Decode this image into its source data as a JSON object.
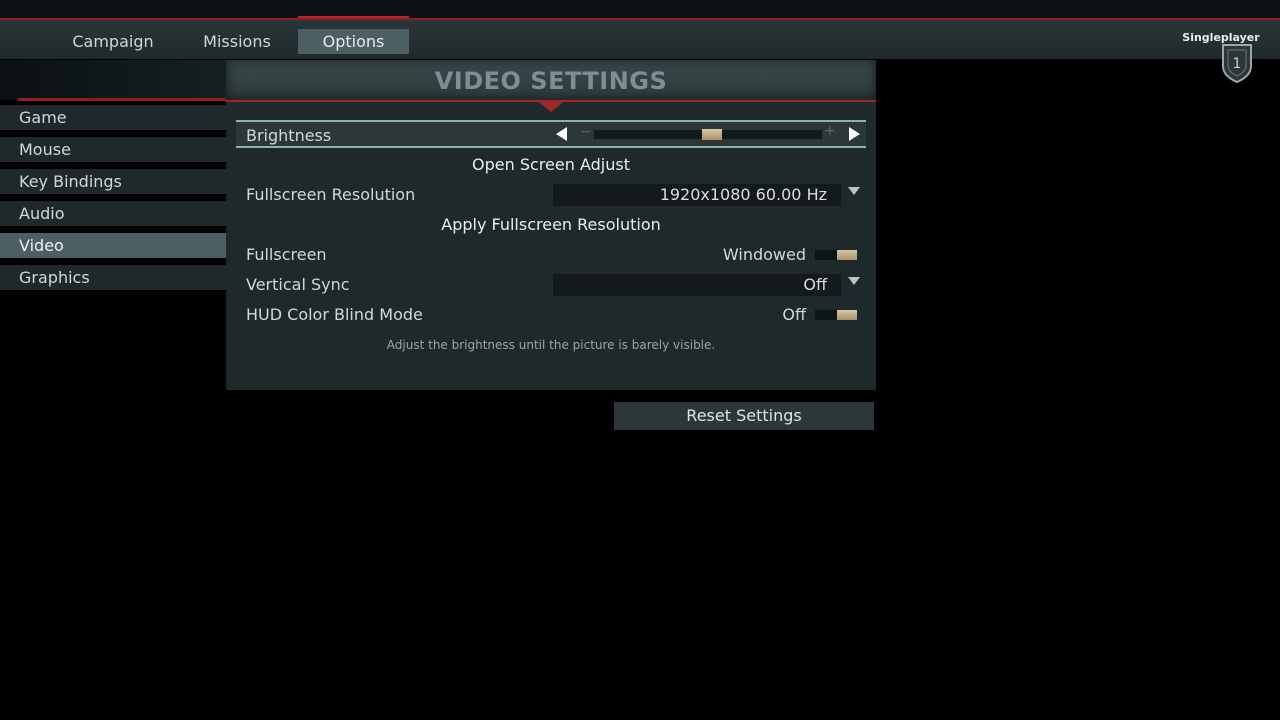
{
  "top_nav": {
    "tabs": [
      {
        "label": "Campaign"
      },
      {
        "label": "Missions"
      },
      {
        "label": "Options"
      }
    ],
    "active_tab": "Options",
    "mode_label": "Singleplayer",
    "mode_badge_number": "1"
  },
  "sidebar": {
    "items": [
      {
        "label": "Game"
      },
      {
        "label": "Mouse"
      },
      {
        "label": "Key Bindings"
      },
      {
        "label": "Audio"
      },
      {
        "label": "Video"
      },
      {
        "label": "Graphics"
      }
    ],
    "active_item": "Video"
  },
  "panel": {
    "title": "VIDEO SETTINGS",
    "brightness": {
      "label": "Brightness",
      "minus": "−",
      "plus": "+",
      "level_fraction": 0.52
    },
    "open_screen_adjust": "Open Screen Adjust",
    "fullscreen_resolution": {
      "label": "Fullscreen Resolution",
      "value": "1920x1080 60.00 Hz"
    },
    "apply_fullscreen_resolution": "Apply Fullscreen Resolution",
    "fullscreen": {
      "label": "Fullscreen",
      "value": "Windowed"
    },
    "vertical_sync": {
      "label": "Vertical Sync",
      "value": "Off"
    },
    "hud_color_blind_mode": {
      "label": "HUD Color Blind Mode",
      "value": "Off"
    },
    "hint": "Adjust the brightness until the picture is barely visible."
  },
  "reset_button_label": "Reset Settings",
  "colors": {
    "accent_red": "#a1262a",
    "active_bg": "#4d5f62",
    "panel_bg": "#1f292b",
    "knob": "#c8b68e"
  }
}
